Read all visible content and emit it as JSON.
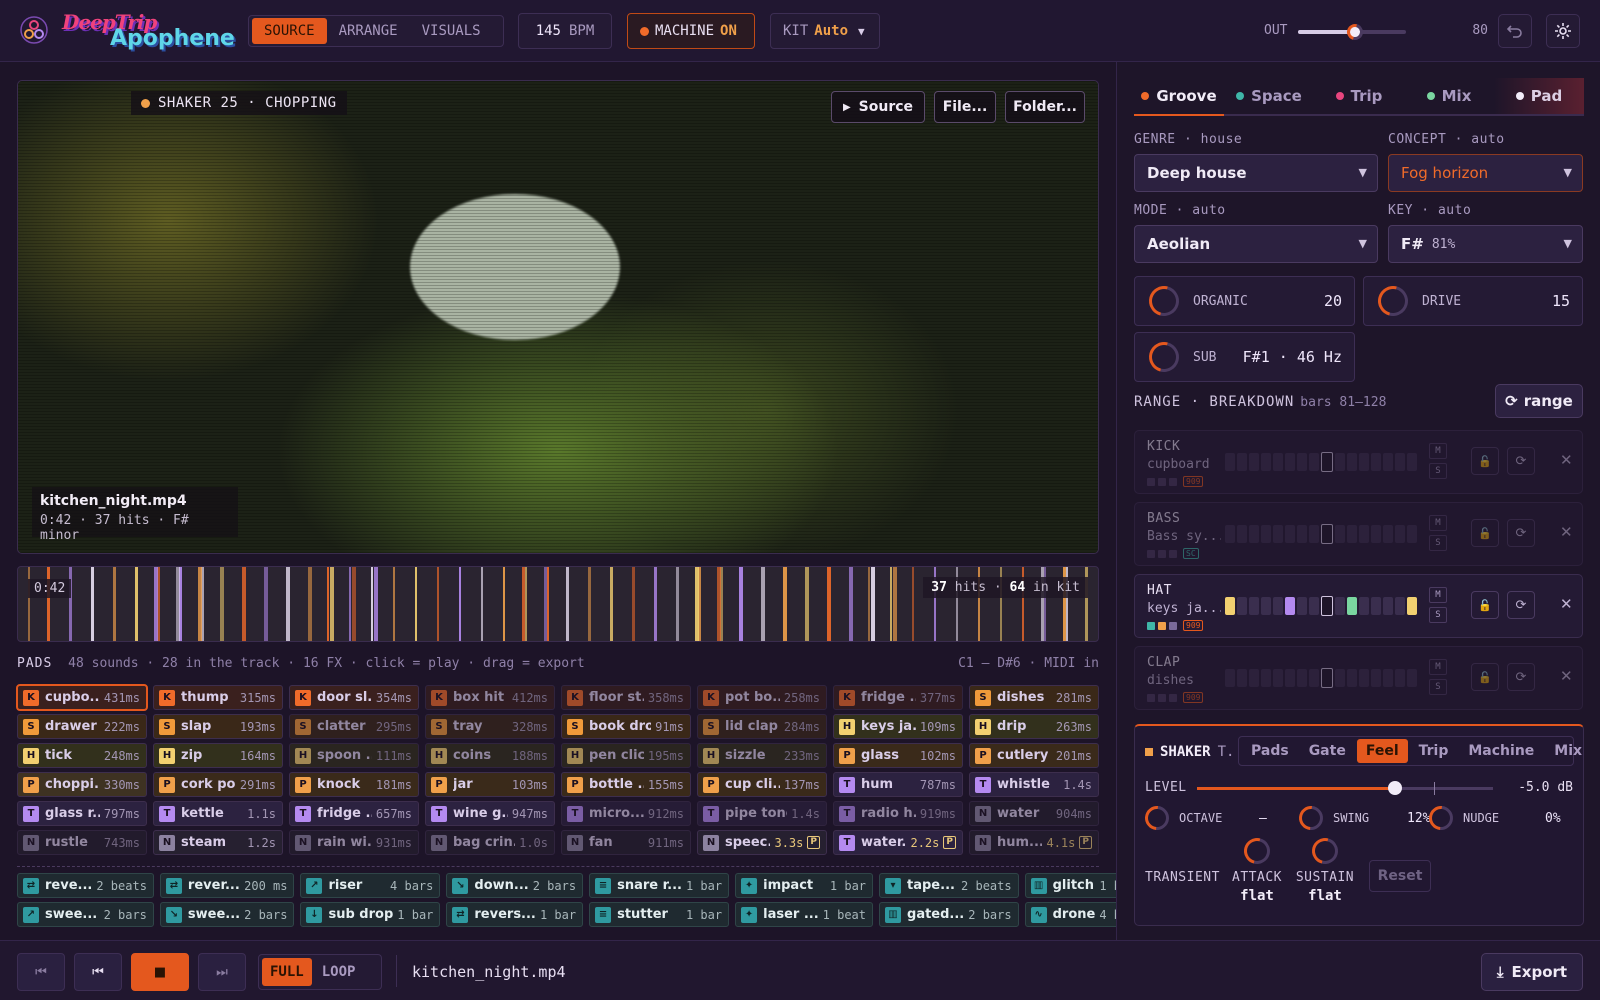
{
  "app": {
    "logo_line1": "DeepTrip",
    "logo_line2": "Apophene"
  },
  "mode_tabs": [
    {
      "label": "SOURCE",
      "active": true
    },
    {
      "label": "ARRANGE",
      "active": false
    },
    {
      "label": "VISUALS",
      "active": false
    }
  ],
  "bpm": {
    "value": "145",
    "unit": "BPM"
  },
  "machine": {
    "label": "MACHINE",
    "state": "ON"
  },
  "kit": {
    "label": "KIT",
    "value": "Auto"
  },
  "output": {
    "label": "OUT",
    "value": "80",
    "level": 0.53
  },
  "colors": {
    "accent": "#e4581e",
    "bg": "#1d1428",
    "panel": "#241a34"
  },
  "video": {
    "tag": "SHAKER 25 · CHOPPING",
    "tag_color": "#f0a04a",
    "source_label": "Source",
    "file_label": "File...",
    "folder_label": "Folder...",
    "file_name": "kitchen_night.mp4",
    "file_meta": "0:42 · 37 hits · F# minor"
  },
  "timeline": {
    "time": "0:42",
    "hits": "37",
    "hits_label": "hits ·",
    "in_kit": "64",
    "in_kit_label": "in kit"
  },
  "pads": {
    "title": "PADS",
    "summary": "48 sounds · 28 in the track · 16 FX · click = play · drag = export",
    "midi": "C1 – D#6 · MIDI in",
    "items": [
      {
        "t": "K",
        "n": "cupbo...",
        "d": "431ms",
        "s": "sel"
      },
      {
        "t": "K",
        "n": "thump",
        "d": "315ms"
      },
      {
        "t": "K",
        "n": "door sl...",
        "d": "354ms"
      },
      {
        "t": "K",
        "n": "box hit",
        "d": "412ms",
        "s": "dim"
      },
      {
        "t": "K",
        "n": "floor st...",
        "d": "358ms",
        "s": "dim"
      },
      {
        "t": "K",
        "n": "pot bo...",
        "d": "258ms",
        "s": "dim"
      },
      {
        "t": "K",
        "n": "fridge ...",
        "d": "377ms",
        "s": "dim"
      },
      {
        "t": "S",
        "n": "dishes",
        "d": "281ms"
      },
      {
        "t": "S",
        "n": "drawer",
        "d": "222ms"
      },
      {
        "t": "S",
        "n": "slap",
        "d": "193ms"
      },
      {
        "t": "S",
        "n": "clatter",
        "d": "295ms",
        "s": "dim"
      },
      {
        "t": "S",
        "n": "tray",
        "d": "328ms",
        "s": "dim"
      },
      {
        "t": "S",
        "n": "book drop",
        "d": "91ms"
      },
      {
        "t": "S",
        "n": "lid clap",
        "d": "284ms",
        "s": "dim"
      },
      {
        "t": "H",
        "n": "keys ja...",
        "d": "109ms"
      },
      {
        "t": "H",
        "n": "drip",
        "d": "263ms"
      },
      {
        "t": "H",
        "n": "tick",
        "d": "248ms"
      },
      {
        "t": "H",
        "n": "zip",
        "d": "164ms"
      },
      {
        "t": "H",
        "n": "spoon ...",
        "d": "111ms",
        "s": "dim"
      },
      {
        "t": "H",
        "n": "coins",
        "d": "188ms",
        "s": "dim"
      },
      {
        "t": "H",
        "n": "pen click",
        "d": "195ms",
        "s": "dim"
      },
      {
        "t": "H",
        "n": "sizzle",
        "d": "233ms",
        "s": "dim"
      },
      {
        "t": "P",
        "n": "glass",
        "d": "102ms"
      },
      {
        "t": "P",
        "n": "cutlery",
        "d": "201ms"
      },
      {
        "t": "P",
        "n": "choppi...",
        "d": "330ms",
        "s": "pf"
      },
      {
        "t": "P",
        "n": "cork pop",
        "d": "291ms"
      },
      {
        "t": "P",
        "n": "knock",
        "d": "181ms"
      },
      {
        "t": "P",
        "n": "jar",
        "d": "103ms"
      },
      {
        "t": "P",
        "n": "bottle ...",
        "d": "155ms"
      },
      {
        "t": "P",
        "n": "cup cli...",
        "d": "137ms"
      },
      {
        "t": "T",
        "n": "hum",
        "d": "787ms"
      },
      {
        "t": "T",
        "n": "whistle",
        "d": "1.4s"
      },
      {
        "t": "T",
        "n": "glass r...",
        "d": "797ms"
      },
      {
        "t": "T",
        "n": "kettle",
        "d": "1.1s"
      },
      {
        "t": "T",
        "n": "fridge ...",
        "d": "657ms"
      },
      {
        "t": "T",
        "n": "wine g...",
        "d": "947ms"
      },
      {
        "t": "T",
        "n": "micro...",
        "d": "912ms",
        "s": "dim"
      },
      {
        "t": "T",
        "n": "pipe tone",
        "d": "1.4s",
        "s": "dim"
      },
      {
        "t": "T",
        "n": "radio h...",
        "d": "919ms",
        "s": "dim"
      },
      {
        "t": "N",
        "n": "water",
        "d": "904ms",
        "s": "dim"
      },
      {
        "t": "N",
        "n": "rustle",
        "d": "743ms",
        "s": "dim"
      },
      {
        "t": "N",
        "n": "steam",
        "d": "1.2s"
      },
      {
        "t": "N",
        "n": "rain wi...",
        "d": "931ms",
        "s": "dim"
      },
      {
        "t": "N",
        "n": "bag crin...",
        "d": "1.0s",
        "s": "dim"
      },
      {
        "t": "N",
        "n": "fan",
        "d": "911ms",
        "s": "dim"
      },
      {
        "t": "N",
        "n": "speec...",
        "d": "3.3s",
        "p": "P"
      },
      {
        "t": "T",
        "n": "water...",
        "d": "2.2s",
        "p": "P"
      },
      {
        "t": "N",
        "n": "hum...",
        "d": "4.1s",
        "p": "P",
        "s": "dim"
      }
    ]
  },
  "fx": [
    {
      "i": "⇄",
      "n": "reve...",
      "d": "2 beats"
    },
    {
      "i": "⇄",
      "n": "rever...",
      "d": "200 ms"
    },
    {
      "i": "↗",
      "n": "riser",
      "d": "4 bars"
    },
    {
      "i": "↘",
      "n": "down...",
      "d": "2 bars"
    },
    {
      "i": "≡",
      "n": "snare r...",
      "d": "1 bar"
    },
    {
      "i": "✦",
      "n": "impact",
      "d": "1 bar"
    },
    {
      "i": "▾",
      "n": "tape...",
      "d": "2 beats"
    },
    {
      "i": "▥",
      "n": "glitch",
      "d": "1 beat"
    },
    {
      "i": "↗",
      "n": "swee...",
      "d": "2 bars"
    },
    {
      "i": "↘",
      "n": "swee...",
      "d": "2 bars"
    },
    {
      "i": "↓",
      "n": "sub drop",
      "d": "1 bar"
    },
    {
      "i": "⇄",
      "n": "revers...",
      "d": "1 bar"
    },
    {
      "i": "≡",
      "n": "stutter",
      "d": "1 bar"
    },
    {
      "i": "✦",
      "n": "laser ...",
      "d": "1 beat"
    },
    {
      "i": "▥",
      "n": "gated...",
      "d": "2 bars"
    },
    {
      "i": "∿",
      "n": "drone",
      "d": "4 bars"
    }
  ],
  "transport": {
    "full_label": "FULL",
    "loop_label": "LOOP",
    "file": "kitchen_night.mp4",
    "export_label": "Export"
  },
  "right_tabs": [
    {
      "label": "Groove",
      "color": "#f06b2a",
      "active": true
    },
    {
      "label": "Space",
      "color": "#3fb6a8"
    },
    {
      "label": "Trip",
      "color": "#e8457e"
    },
    {
      "label": "Mix",
      "color": "#7ad6a0"
    },
    {
      "label": "Pad",
      "color": "#f2ecf8"
    }
  ],
  "groove": {
    "genre_label": "GENRE · house",
    "genre_value": "Deep house",
    "concept_label": "CONCEPT · auto",
    "concept_value": "Fog horizon",
    "mode_label": "MODE · auto",
    "mode_value": "Aeolian",
    "key_label": "KEY · auto",
    "key_value": "F#",
    "key_conf": "81%",
    "organic_label": "ORGANIC",
    "organic_value": "20",
    "drive_label": "DRIVE",
    "drive_value": "15",
    "sub_label": "SUB",
    "sub_value": "F#1 · 46 Hz"
  },
  "range": {
    "label": "RANGE · BREAKDOWN",
    "bars": "bars 81–128",
    "button": "range"
  },
  "tracks": [
    {
      "name": "KICK",
      "sub": "cupboard",
      "badge": "909",
      "badge_color": "#e4581e",
      "dim": true,
      "tags": [
        "#4a3a60",
        "#4a3a60",
        "#4a3a60"
      ],
      "steps": []
    },
    {
      "name": "BASS",
      "sub": "Bass sy...",
      "badge": "SC",
      "badge_color": "#3fb6a8",
      "dim": true,
      "tags": [
        "#4a3a60",
        "#4a3a60",
        "#4a3a60"
      ],
      "steps": []
    },
    {
      "name": "HAT",
      "sub": "keys ja...",
      "badge": "909",
      "badge_color": "#e4581e",
      "dim": false,
      "tags": [
        "#3fb6a8",
        "#f0a04a",
        "#7a6a9a"
      ],
      "steps": [
        0,
        5,
        10,
        15
      ]
    },
    {
      "name": "CLAP",
      "sub": "dishes",
      "badge": "909",
      "badge_color": "#e4581e",
      "dim": true,
      "tags": [
        "#4a3a60",
        "#4a3a60",
        "#4a3a60"
      ],
      "steps": []
    }
  ],
  "shaker": {
    "title": "SHAKER",
    "suffix": "T.",
    "tabs": [
      {
        "label": "Pads"
      },
      {
        "label": "Gate"
      },
      {
        "label": "Feel",
        "active": true
      },
      {
        "label": "Trip"
      },
      {
        "label": "Machine"
      },
      {
        "label": "Mix"
      }
    ],
    "level_label": "LEVEL",
    "level_value": "-5.0 dB",
    "level": 0.67,
    "octave_label": "OCTAVE",
    "octave_value": "–",
    "swing_label": "SWING",
    "swing_value": "12%",
    "nudge_label": "NUDGE",
    "nudge_value": "0%",
    "transient_label": "TRANSIENT",
    "attack_label": "ATTACK",
    "attack_value": "flat",
    "sustain_label": "SUSTAIN",
    "sustain_value": "flat",
    "reset_label": "Reset"
  }
}
